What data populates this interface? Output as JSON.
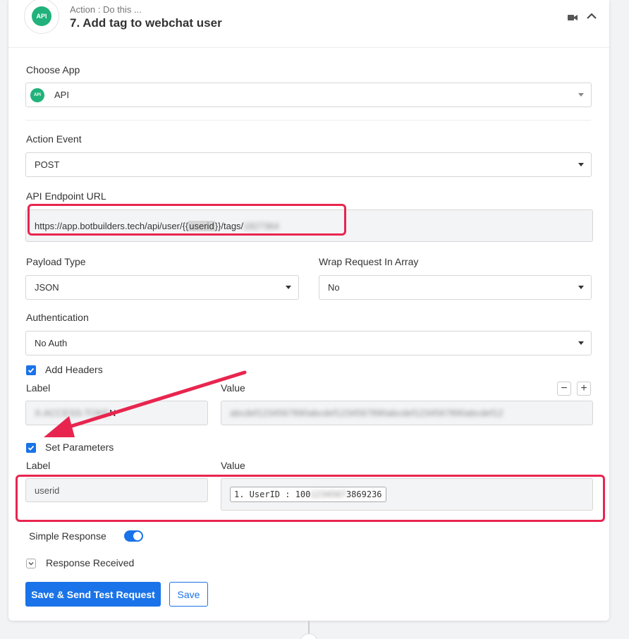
{
  "header": {
    "subtitle": "Action : Do this ...",
    "title": "7. Add tag to webchat user",
    "logo_text": "API"
  },
  "choose_app": {
    "label": "Choose App",
    "value": "API",
    "logo_text": "API"
  },
  "action_event": {
    "label": "Action Event",
    "value": "POST"
  },
  "endpoint": {
    "label": "API Endpoint URL",
    "prefix": "https://app.botbuilders.tech/api/user/{{",
    "variable": "userid",
    "suffix": "}}/tags/",
    "redacted": "1827364"
  },
  "payload_type": {
    "label": "Payload Type",
    "value": "JSON"
  },
  "wrap_request": {
    "label": "Wrap Request In Array",
    "value": "No"
  },
  "authentication": {
    "label": "Authentication",
    "value": "No Auth"
  },
  "headers": {
    "checkbox_label": "Add Headers",
    "col_label": "Label",
    "col_value": "Value",
    "minus": "−",
    "plus": "+",
    "label_value_redacted": "X-ACCESS-TOKE",
    "label_value_visible": "N",
    "value_redacted": "abcdef1234567890abcdef1234567890abcdef1234567890abcdef12"
  },
  "parameters": {
    "checkbox_label": "Set Parameters",
    "col_label": "Label",
    "col_value": "Value",
    "label_value": "userid",
    "value_prefix": "1. UserID : 100",
    "value_redacted": "1234567",
    "value_suffix": "3869236"
  },
  "simple_response": {
    "label": "Simple Response"
  },
  "response_received": {
    "label": "Response Received"
  },
  "buttons": {
    "save_send": "Save & Send Test Request",
    "save": "Save"
  },
  "colors": {
    "primary": "#1a73e8",
    "highlight": "#e8254f",
    "app_green": "#20b27a"
  }
}
